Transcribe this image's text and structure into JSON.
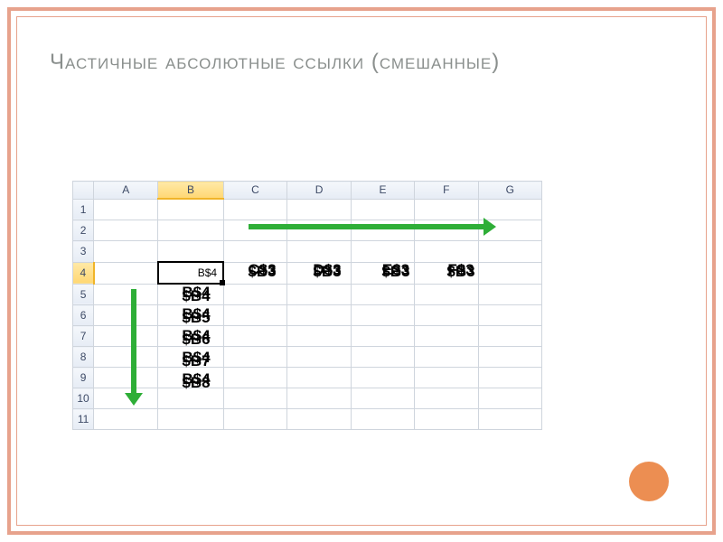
{
  "title": "Частичные абсолютные ссылки (смешанные)",
  "sheet": {
    "row_corner": "",
    "cols": {
      "A": "A",
      "B": "B",
      "C": "C",
      "D": "D",
      "E": "E",
      "F": "F",
      "G": "G"
    },
    "rows": {
      "r1": "1",
      "r2": "2",
      "r3": "3",
      "r4": "4",
      "r5": "5",
      "r6": "6",
      "r7": "7",
      "r8": "8",
      "r9": "9",
      "r10": "10",
      "r11": "11"
    },
    "selected_cell_label": "B4",
    "selected_value": "B$4"
  },
  "overlay": {
    "row": {
      "c": {
        "a": "C$3",
        "b": "$B3"
      },
      "d": {
        "a": "D$3",
        "b": "$B3"
      },
      "e": {
        "a": "E$3",
        "b": "$B3"
      },
      "f": {
        "a": "F$3",
        "b": "$B3"
      }
    },
    "col": {
      "r5": {
        "a": "B$4",
        "b": "$B4"
      },
      "r6": {
        "a": "B$4",
        "b": "$B5"
      },
      "r7": {
        "a": "B$4",
        "b": "$B6"
      },
      "r8": {
        "a": "B$4",
        "b": "$B7"
      },
      "r9": {
        "a": "B$4",
        "b": "$B8"
      }
    }
  },
  "accent_color": "#ec8e52"
}
